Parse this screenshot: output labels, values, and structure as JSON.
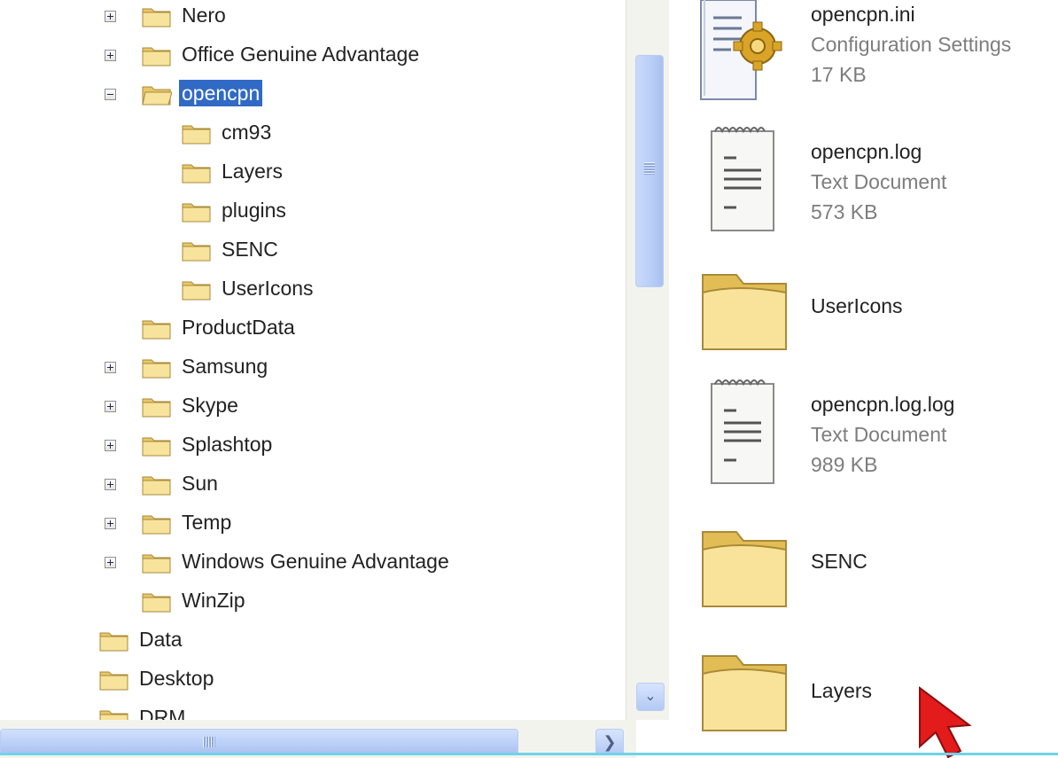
{
  "tree": {
    "items": [
      {
        "label": "Nero",
        "expander": "plus"
      },
      {
        "label": "Office Genuine Advantage",
        "expander": "plus"
      },
      {
        "label": "opencpn",
        "expander": "minus",
        "selected": true
      },
      {
        "label": "cm93"
      },
      {
        "label": "Layers"
      },
      {
        "label": "plugins"
      },
      {
        "label": "SENC"
      },
      {
        "label": "UserIcons"
      },
      {
        "label": "ProductData"
      },
      {
        "label": "Samsung",
        "expander": "plus"
      },
      {
        "label": "Skype",
        "expander": "plus"
      },
      {
        "label": "Splashtop",
        "expander": "plus"
      },
      {
        "label": "Sun",
        "expander": "plus"
      },
      {
        "label": "Temp",
        "expander": "plus"
      },
      {
        "label": "Windows Genuine Advantage",
        "expander": "plus"
      },
      {
        "label": "WinZip"
      },
      {
        "label": "Data"
      },
      {
        "label": "Desktop"
      },
      {
        "label": "DRM"
      }
    ]
  },
  "files": {
    "items": [
      {
        "name": "opencpn.ini",
        "type": "Configuration Settings",
        "size": "17 KB",
        "icon": "config-settings-icon"
      },
      {
        "name": "opencpn.log",
        "type": "Text Document",
        "size": "573 KB",
        "icon": "text-document-icon"
      },
      {
        "name": "UserIcons",
        "icon": "folder-icon"
      },
      {
        "name": "opencpn.log.log",
        "type": "Text Document",
        "size": "989 KB",
        "icon": "text-document-icon"
      },
      {
        "name": "SENC",
        "icon": "folder-icon"
      },
      {
        "name": "Layers",
        "icon": "folder-icon"
      }
    ]
  },
  "colors": {
    "selection": "#316ac5",
    "folder": "#f6d87e",
    "scrollbar": "#b9cff7",
    "cursor": "#e31b1b"
  }
}
